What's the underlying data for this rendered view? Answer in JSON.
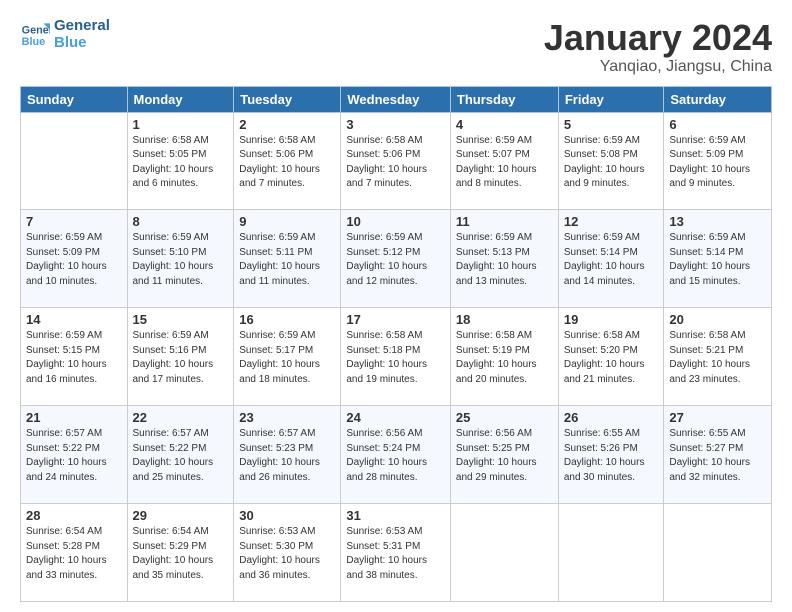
{
  "header": {
    "logo_line1": "General",
    "logo_line2": "Blue",
    "title": "January 2024",
    "subtitle": "Yanqiao, Jiangsu, China"
  },
  "days_of_week": [
    "Sunday",
    "Monday",
    "Tuesday",
    "Wednesday",
    "Thursday",
    "Friday",
    "Saturday"
  ],
  "weeks": [
    [
      {
        "day": "",
        "sunrise": "",
        "sunset": "",
        "daylight": ""
      },
      {
        "day": "1",
        "sunrise": "Sunrise: 6:58 AM",
        "sunset": "Sunset: 5:05 PM",
        "daylight": "Daylight: 10 hours and 6 minutes."
      },
      {
        "day": "2",
        "sunrise": "Sunrise: 6:58 AM",
        "sunset": "Sunset: 5:06 PM",
        "daylight": "Daylight: 10 hours and 7 minutes."
      },
      {
        "day": "3",
        "sunrise": "Sunrise: 6:58 AM",
        "sunset": "Sunset: 5:06 PM",
        "daylight": "Daylight: 10 hours and 7 minutes."
      },
      {
        "day": "4",
        "sunrise": "Sunrise: 6:59 AM",
        "sunset": "Sunset: 5:07 PM",
        "daylight": "Daylight: 10 hours and 8 minutes."
      },
      {
        "day": "5",
        "sunrise": "Sunrise: 6:59 AM",
        "sunset": "Sunset: 5:08 PM",
        "daylight": "Daylight: 10 hours and 9 minutes."
      },
      {
        "day": "6",
        "sunrise": "Sunrise: 6:59 AM",
        "sunset": "Sunset: 5:09 PM",
        "daylight": "Daylight: 10 hours and 9 minutes."
      }
    ],
    [
      {
        "day": "7",
        "sunrise": "Sunrise: 6:59 AM",
        "sunset": "Sunset: 5:09 PM",
        "daylight": "Daylight: 10 hours and 10 minutes."
      },
      {
        "day": "8",
        "sunrise": "Sunrise: 6:59 AM",
        "sunset": "Sunset: 5:10 PM",
        "daylight": "Daylight: 10 hours and 11 minutes."
      },
      {
        "day": "9",
        "sunrise": "Sunrise: 6:59 AM",
        "sunset": "Sunset: 5:11 PM",
        "daylight": "Daylight: 10 hours and 11 minutes."
      },
      {
        "day": "10",
        "sunrise": "Sunrise: 6:59 AM",
        "sunset": "Sunset: 5:12 PM",
        "daylight": "Daylight: 10 hours and 12 minutes."
      },
      {
        "day": "11",
        "sunrise": "Sunrise: 6:59 AM",
        "sunset": "Sunset: 5:13 PM",
        "daylight": "Daylight: 10 hours and 13 minutes."
      },
      {
        "day": "12",
        "sunrise": "Sunrise: 6:59 AM",
        "sunset": "Sunset: 5:14 PM",
        "daylight": "Daylight: 10 hours and 14 minutes."
      },
      {
        "day": "13",
        "sunrise": "Sunrise: 6:59 AM",
        "sunset": "Sunset: 5:14 PM",
        "daylight": "Daylight: 10 hours and 15 minutes."
      }
    ],
    [
      {
        "day": "14",
        "sunrise": "Sunrise: 6:59 AM",
        "sunset": "Sunset: 5:15 PM",
        "daylight": "Daylight: 10 hours and 16 minutes."
      },
      {
        "day": "15",
        "sunrise": "Sunrise: 6:59 AM",
        "sunset": "Sunset: 5:16 PM",
        "daylight": "Daylight: 10 hours and 17 minutes."
      },
      {
        "day": "16",
        "sunrise": "Sunrise: 6:59 AM",
        "sunset": "Sunset: 5:17 PM",
        "daylight": "Daylight: 10 hours and 18 minutes."
      },
      {
        "day": "17",
        "sunrise": "Sunrise: 6:58 AM",
        "sunset": "Sunset: 5:18 PM",
        "daylight": "Daylight: 10 hours and 19 minutes."
      },
      {
        "day": "18",
        "sunrise": "Sunrise: 6:58 AM",
        "sunset": "Sunset: 5:19 PM",
        "daylight": "Daylight: 10 hours and 20 minutes."
      },
      {
        "day": "19",
        "sunrise": "Sunrise: 6:58 AM",
        "sunset": "Sunset: 5:20 PM",
        "daylight": "Daylight: 10 hours and 21 minutes."
      },
      {
        "day": "20",
        "sunrise": "Sunrise: 6:58 AM",
        "sunset": "Sunset: 5:21 PM",
        "daylight": "Daylight: 10 hours and 23 minutes."
      }
    ],
    [
      {
        "day": "21",
        "sunrise": "Sunrise: 6:57 AM",
        "sunset": "Sunset: 5:22 PM",
        "daylight": "Daylight: 10 hours and 24 minutes."
      },
      {
        "day": "22",
        "sunrise": "Sunrise: 6:57 AM",
        "sunset": "Sunset: 5:22 PM",
        "daylight": "Daylight: 10 hours and 25 minutes."
      },
      {
        "day": "23",
        "sunrise": "Sunrise: 6:57 AM",
        "sunset": "Sunset: 5:23 PM",
        "daylight": "Daylight: 10 hours and 26 minutes."
      },
      {
        "day": "24",
        "sunrise": "Sunrise: 6:56 AM",
        "sunset": "Sunset: 5:24 PM",
        "daylight": "Daylight: 10 hours and 28 minutes."
      },
      {
        "day": "25",
        "sunrise": "Sunrise: 6:56 AM",
        "sunset": "Sunset: 5:25 PM",
        "daylight": "Daylight: 10 hours and 29 minutes."
      },
      {
        "day": "26",
        "sunrise": "Sunrise: 6:55 AM",
        "sunset": "Sunset: 5:26 PM",
        "daylight": "Daylight: 10 hours and 30 minutes."
      },
      {
        "day": "27",
        "sunrise": "Sunrise: 6:55 AM",
        "sunset": "Sunset: 5:27 PM",
        "daylight": "Daylight: 10 hours and 32 minutes."
      }
    ],
    [
      {
        "day": "28",
        "sunrise": "Sunrise: 6:54 AM",
        "sunset": "Sunset: 5:28 PM",
        "daylight": "Daylight: 10 hours and 33 minutes."
      },
      {
        "day": "29",
        "sunrise": "Sunrise: 6:54 AM",
        "sunset": "Sunset: 5:29 PM",
        "daylight": "Daylight: 10 hours and 35 minutes."
      },
      {
        "day": "30",
        "sunrise": "Sunrise: 6:53 AM",
        "sunset": "Sunset: 5:30 PM",
        "daylight": "Daylight: 10 hours and 36 minutes."
      },
      {
        "day": "31",
        "sunrise": "Sunrise: 6:53 AM",
        "sunset": "Sunset: 5:31 PM",
        "daylight": "Daylight: 10 hours and 38 minutes."
      },
      {
        "day": "",
        "sunrise": "",
        "sunset": "",
        "daylight": ""
      },
      {
        "day": "",
        "sunrise": "",
        "sunset": "",
        "daylight": ""
      },
      {
        "day": "",
        "sunrise": "",
        "sunset": "",
        "daylight": ""
      }
    ]
  ]
}
